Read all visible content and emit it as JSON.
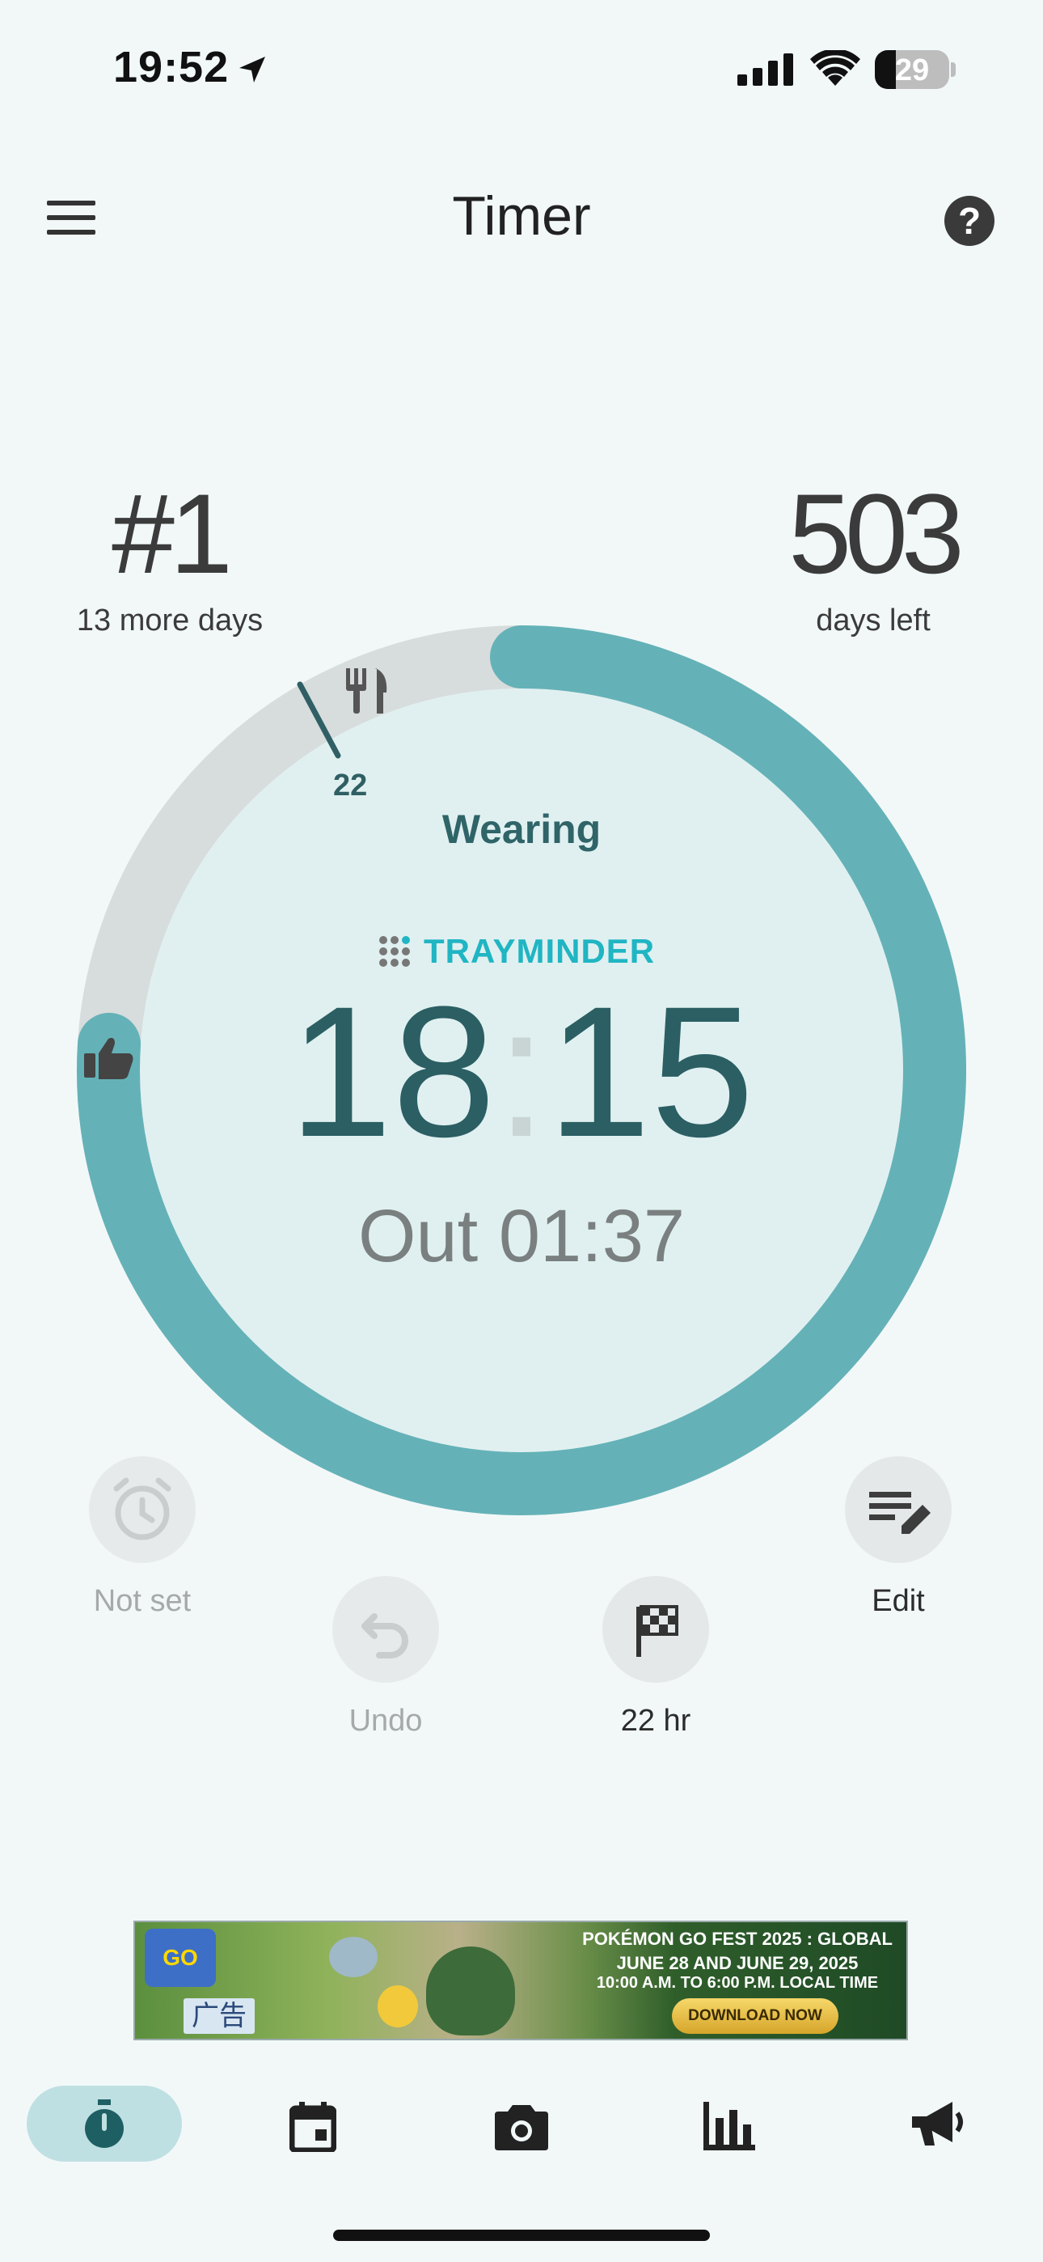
{
  "status_bar": {
    "time": "19:52",
    "battery": "29"
  },
  "app_bar": {
    "title": "Timer"
  },
  "stats": {
    "rank": "#1",
    "rank_sub": "13 more days",
    "days": "503",
    "days_sub": "days left"
  },
  "timer": {
    "state": "Wearing",
    "brand": "TRAYMINDER",
    "worn_hours": "18",
    "worn_minutes": "15",
    "out_label": "Out",
    "out_time": "01:37",
    "goal_tick_label": "22",
    "worn_fraction": 0.76
  },
  "actions": {
    "alarm_label": "Not set",
    "edit_label": "Edit",
    "undo_label": "Undo",
    "goal_label": "22 hr"
  },
  "ad": {
    "line1": "POKÉMON GO FEST 2025 : GLOBAL",
    "line2": "JUNE 28 AND JUNE 29, 2025",
    "line3": "10:00 A.M. TO 6:00 P.M. LOCAL TIME",
    "cta": "DOWNLOAD NOW",
    "tag": "广告",
    "logo": "GO"
  },
  "nav": {
    "items": [
      "timer-icon",
      "calendar-icon",
      "camera-icon",
      "stats-icon",
      "megaphone-icon"
    ],
    "active": "timer-icon"
  },
  "colors": {
    "ring_worn": "#64b2b8",
    "ring_track": "#d7dcdc",
    "inner_fill": "#e0f0f0",
    "accent": "#2b5f63",
    "brand": "#20b5c3"
  }
}
